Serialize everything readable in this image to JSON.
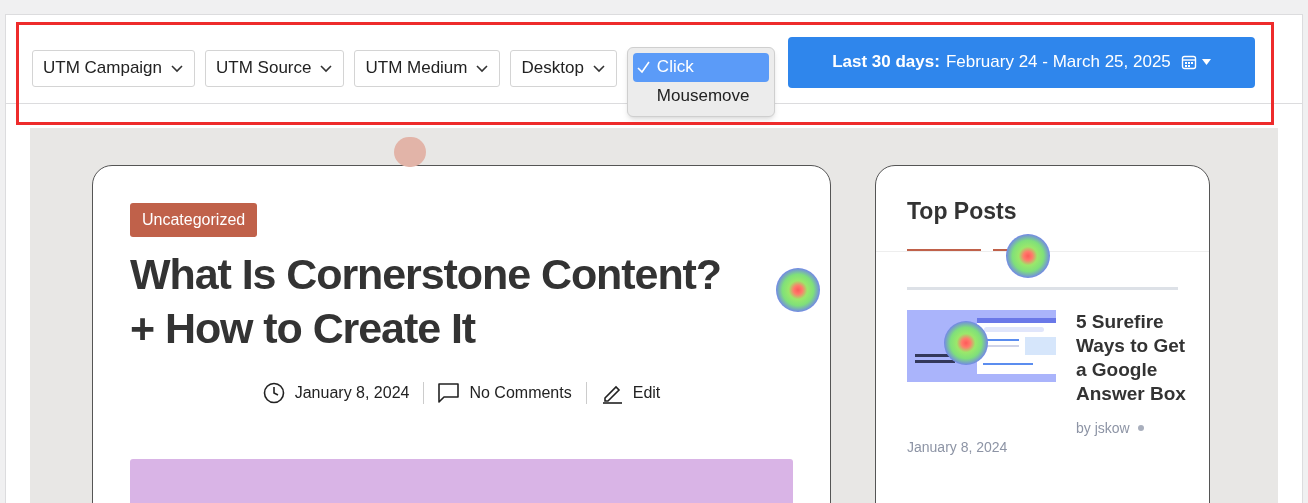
{
  "filters": [
    {
      "label": "UTM Campaign"
    },
    {
      "label": "UTM Source"
    },
    {
      "label": "UTM Medium"
    },
    {
      "label": "Desktop"
    }
  ],
  "event_menu": {
    "options": [
      {
        "label": "Click",
        "selected": true
      },
      {
        "label": "Mousemove",
        "selected": false
      }
    ]
  },
  "date_range": {
    "label": "Last 30 days:",
    "value": "February 24 - March 25, 2025"
  },
  "article": {
    "category": "Uncategorized",
    "title_lines": [
      "What Is Cornerstone Content?",
      "+ How to Create It"
    ],
    "date": "January 8, 2024",
    "comments": "No Comments",
    "edit": "Edit"
  },
  "sidebar": {
    "title": "Top Posts",
    "posts": [
      {
        "title": "5 Surefire Ways to Get a Google Answer Box",
        "author": "by jskow",
        "date": "January 8, 2024"
      }
    ]
  }
}
